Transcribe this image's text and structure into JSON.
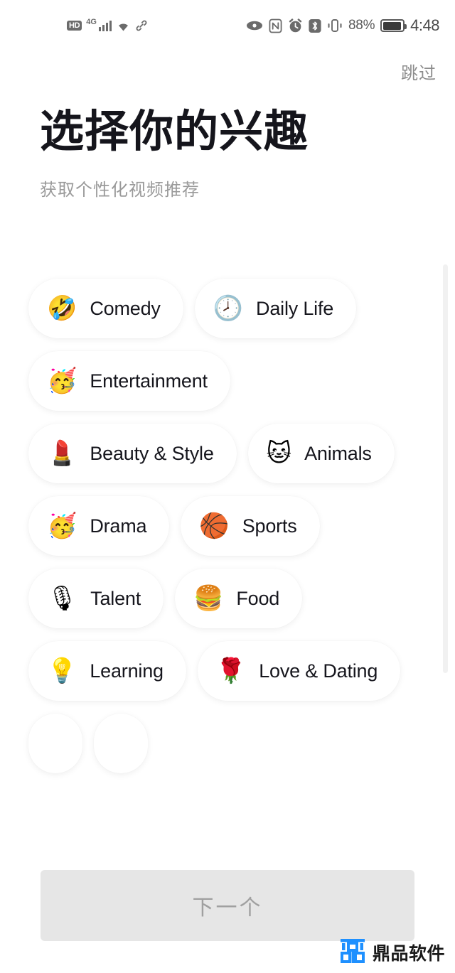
{
  "status_bar": {
    "hd_label": "HD",
    "network_label": "4G",
    "signal_icon": "signal-bars-icon",
    "wifi_icon": "wifi-icon",
    "link_icon": "link-icon",
    "eye_icon": "eye-icon",
    "nfc_icon": "nfc-icon",
    "alarm_icon": "alarm-clock-icon",
    "bluetooth_icon": "bluetooth-icon",
    "vibrate_icon": "vibrate-icon",
    "battery_percent": "88%",
    "battery_icon": "battery-icon",
    "time": "4:48"
  },
  "header": {
    "skip_label": "跳过",
    "title": "选择你的兴趣",
    "subtitle": "获取个性化视频推荐"
  },
  "interests": {
    "chips": [
      {
        "emoji": "🤣",
        "emoji_name": "rolling-on-the-floor-laughing-emoji",
        "label": "Comedy"
      },
      {
        "emoji": "🕗",
        "emoji_name": "clock-emoji",
        "label": "Daily Life"
      },
      {
        "emoji": "🥳",
        "emoji_name": "partying-face-emoji",
        "label": "Entertainment"
      },
      {
        "emoji": "💄",
        "emoji_name": "lipstick-emoji",
        "label": "Beauty & Style"
      },
      {
        "emoji": "🐱",
        "emoji_name": "cat-face-emoji",
        "label": "Animals"
      },
      {
        "emoji": "🥳",
        "emoji_name": "partying-face-emoji",
        "label": "Drama"
      },
      {
        "emoji": "🏀",
        "emoji_name": "basketball-emoji",
        "label": "Sports"
      },
      {
        "emoji": "🎙",
        "emoji_name": "studio-microphone-emoji",
        "label": "Talent"
      },
      {
        "emoji": "🍔",
        "emoji_name": "hamburger-emoji",
        "label": "Food"
      },
      {
        "emoji": "💡",
        "emoji_name": "light-bulb-emoji",
        "label": "Learning"
      },
      {
        "emoji": "🌹",
        "emoji_name": "rose-emoji",
        "label": "Love & Dating"
      },
      {
        "emoji": "",
        "emoji_name": "hidden-emoji",
        "label": ""
      },
      {
        "emoji": "",
        "emoji_name": "hidden-emoji",
        "label": ""
      }
    ]
  },
  "footer": {
    "next_label": "下一个",
    "watermark_text": "鼎品软件",
    "watermark_logo": "dingpin-logo-icon",
    "watermark_color": "#1e90ff"
  }
}
